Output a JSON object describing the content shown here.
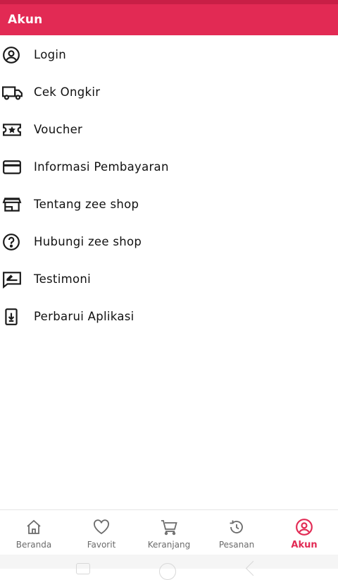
{
  "header": {
    "title": "Akun"
  },
  "menu": [
    {
      "label": "Login",
      "icon": "account-circle-icon"
    },
    {
      "label": "Cek Ongkir",
      "icon": "truck-icon"
    },
    {
      "label": "Voucher",
      "icon": "ticket-star-icon"
    },
    {
      "label": "Informasi Pembayaran",
      "icon": "credit-card-icon"
    },
    {
      "label": "Tentang zee shop",
      "icon": "store-icon"
    },
    {
      "label": "Hubungi zee shop",
      "icon": "help-circle-icon"
    },
    {
      "label": "Testimoni",
      "icon": "comment-edit-icon"
    },
    {
      "label": "Perbarui Aplikasi",
      "icon": "download-box-icon"
    }
  ],
  "bottom_nav": [
    {
      "label": "Beranda",
      "icon": "home-icon",
      "active": false
    },
    {
      "label": "Favorit",
      "icon": "heart-icon",
      "active": false
    },
    {
      "label": "Keranjang",
      "icon": "cart-icon",
      "active": false
    },
    {
      "label": "Pesanan",
      "icon": "history-icon",
      "active": false
    },
    {
      "label": "Akun",
      "icon": "account-circle-icon",
      "active": true
    }
  ],
  "colors": {
    "primary": "#e22a54",
    "icon": "#1a1a1a",
    "nav_inactive": "#6b6b6b"
  }
}
